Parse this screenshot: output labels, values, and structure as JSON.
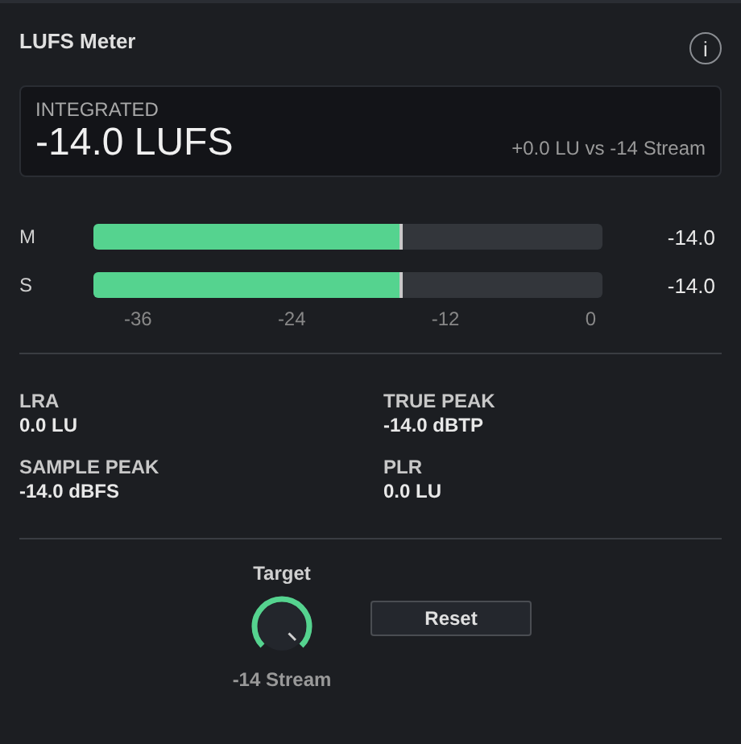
{
  "panel": {
    "title": "LUFS Meter",
    "info_icon": "i"
  },
  "integrated": {
    "label": "INTEGRATED",
    "value": "-14.0 LUFS",
    "comparison": "+0.0 LU vs -14 Stream"
  },
  "meters": [
    {
      "name": "M",
      "level": 0.607,
      "reading": "-14.0"
    },
    {
      "name": "S",
      "level": 0.607,
      "reading": "-14.0"
    }
  ],
  "scale": [
    "-36",
    "-24",
    "-12",
    "0"
  ],
  "stats": [
    {
      "label": "LRA",
      "value": "0.0 LU"
    },
    {
      "label": "TRUE PEAK",
      "value": "-14.0 dBTP"
    },
    {
      "label": "SAMPLE PEAK",
      "value": "-14.0 dBFS"
    },
    {
      "label": "PLR",
      "value": "0.0 LU"
    }
  ],
  "target": {
    "label": "Target",
    "value": "-14 Stream"
  },
  "buttons": [
    "Reset"
  ]
}
